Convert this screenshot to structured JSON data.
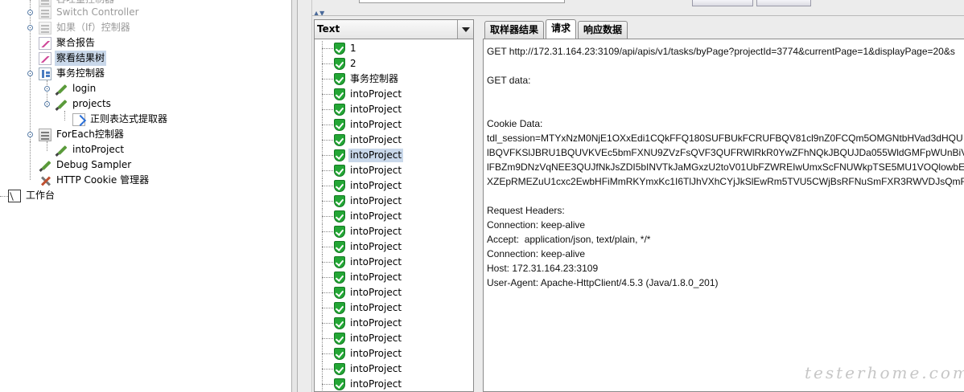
{
  "left_tree": {
    "items": [
      {
        "label": "吞吐量控制器",
        "icon": "throughput-controller-icon",
        "disabled": true
      },
      {
        "label": "Switch Controller",
        "icon": "switch-controller-icon",
        "disabled": true
      },
      {
        "label": "如果（If）控制器",
        "icon": "if-controller-icon",
        "disabled": true
      },
      {
        "label": "聚合报告",
        "icon": "aggregate-report-icon"
      },
      {
        "label": "察看结果树",
        "icon": "result-tree-icon",
        "selected": true
      },
      {
        "label": "事务控制器",
        "icon": "transaction-controller-icon"
      },
      {
        "label": "login",
        "icon": "http-sampler-icon"
      },
      {
        "label": "projects",
        "icon": "http-sampler-icon"
      },
      {
        "label": "正则表达式提取器",
        "icon": "regex-extractor-icon"
      },
      {
        "label": "ForEach控制器",
        "icon": "foreach-controller-icon"
      },
      {
        "label": "intoProject",
        "icon": "http-sampler-icon"
      },
      {
        "label": "Debug Sampler",
        "icon": "debug-sampler-icon"
      },
      {
        "label": "HTTP Cookie 管理器",
        "icon": "cookie-manager-icon"
      },
      {
        "label": "工作台",
        "icon": "workbench-icon"
      }
    ]
  },
  "result_panel": {
    "renderer": "Text",
    "items": [
      "1",
      "2",
      "事务控制器",
      "intoProject",
      "intoProject",
      "intoProject",
      "intoProject",
      "intoProject",
      "intoProject",
      "intoProject",
      "intoProject",
      "intoProject",
      "intoProject",
      "intoProject",
      "intoProject",
      "intoProject",
      "intoProject",
      "intoProject",
      "intoProject",
      "intoProject",
      "intoProject",
      "intoProject",
      "intoProject"
    ],
    "selected_index": 7,
    "status_icon": "success-shield-icon"
  },
  "detail": {
    "tabs": [
      "取样器结果",
      "请求",
      "响应数据"
    ],
    "active_tab": 1,
    "lines": [
      "GET http://172.31.164.23:3109/api/apis/v1/tasks/byPage?projectId=3774&currentPage=1&displayPage=20&s",
      "",
      "GET data:",
      "",
      "",
      "Cookie Data:",
      "tdl_session=MTYxNzM0NjE1OXxEdi1CQkFFQ180SUFBUkFCRUFBQV81cl9nZ0FCQm5OMGNtbHVad3dHQU",
      "lBQVFKSlJBRU1BQUVKVEc5bmFXNU9ZVzFsQVF3QUFRWlRkR0YwZFhNQkJBQUJDa055WldGMFpWUnBiV",
      "lFBZm9DNzVqNEE3QUJfNkJsZDI5bINVTkJaMGxzU2toV01UbFZWREIwUmxScFNUWkpTSE5MU1VOQlowbE",
      "XZEpRMEZuU1cxc2EwbHFiMmRKYmxKc1I6TlJhVXhCYjJkSlEwRm5TVU5CWjBsRFNuSmFXR3RWVDJsQmF",
      "",
      "Request Headers:",
      "Connection: keep-alive",
      "Accept:  application/json, text/plain, */*",
      "Connection: keep-alive",
      "Host: 172.31.164.23:3109",
      "User-Agent: Apache-HttpClient/4.5.3 (Java/1.8.0_201)"
    ]
  },
  "watermark": "testerhome.com",
  "colors": {
    "selection": "#c9d8ea",
    "success_green": "#23a635",
    "disabled_text": "#9a9a9a"
  }
}
